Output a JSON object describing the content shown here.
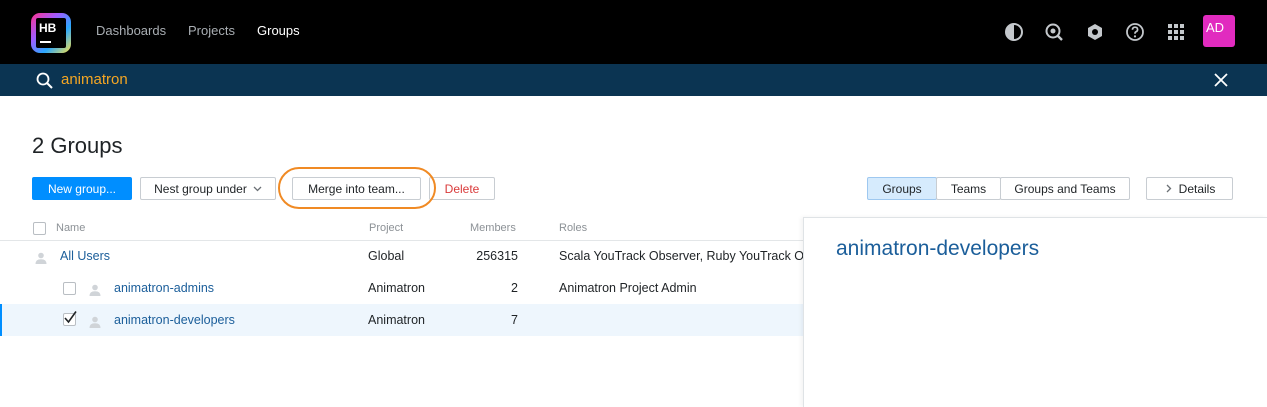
{
  "app": {
    "logo_text": "HB",
    "nav": [
      "Dashboards",
      "Projects",
      "Groups"
    ],
    "avatar_initials": "AD",
    "icons": [
      "contrast-icon",
      "search-settings-icon",
      "hexagon-settings-icon",
      "help-icon",
      "apps-grid-icon"
    ]
  },
  "search": {
    "query": "animatron"
  },
  "page": {
    "title": "2 Groups"
  },
  "toolbar": {
    "new_group": "New group...",
    "nest_group": "Nest group under",
    "merge": "Merge into team...",
    "delete": "Delete",
    "filter_groups": "Groups",
    "filter_teams": "Teams",
    "filter_both": "Groups and Teams",
    "details": "Details"
  },
  "table": {
    "headers": {
      "name": "Name",
      "project": "Project",
      "members": "Members",
      "roles": "Roles"
    },
    "rows": [
      {
        "name": "All Users",
        "project": "Global",
        "members": "256315",
        "roles": "Scala YouTrack Observer, Ruby YouTrack Ob"
      },
      {
        "name": "animatron-admins",
        "project": "Animatron",
        "members": "2",
        "roles": "Animatron Project Admin"
      },
      {
        "name": "animatron-developers",
        "project": "Animatron",
        "members": "7",
        "roles": ""
      }
    ]
  },
  "details": {
    "title": "animatron-developers"
  },
  "colors": {
    "primary": "#008eff",
    "search_bar": "#0b3452",
    "search_text": "#f5a623",
    "link": "#1b5e9a",
    "danger": "#d93a3a",
    "highlight": "#f08a24",
    "avatar": "#e12bbf"
  }
}
